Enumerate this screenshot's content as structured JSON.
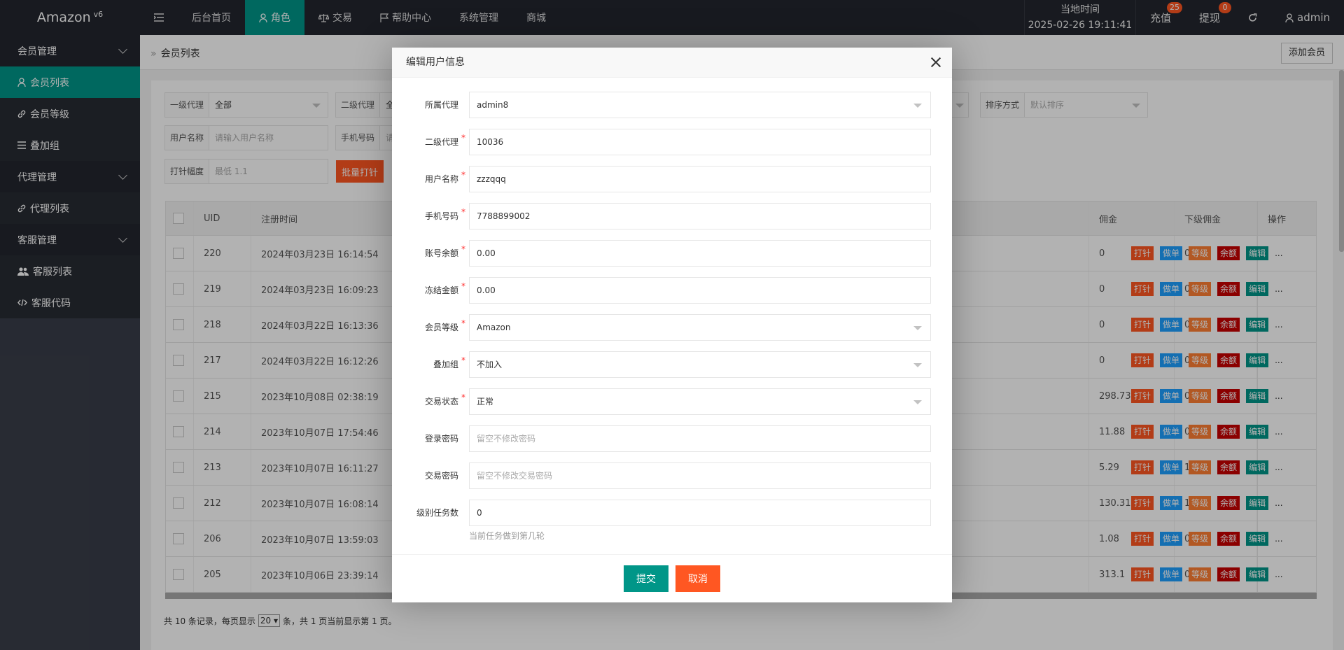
{
  "app": {
    "logo": "Amazon",
    "version": "v6"
  },
  "topnav": [
    {
      "label": "后台首页",
      "icon": ""
    },
    {
      "label": "角色",
      "icon": "user-icon"
    },
    {
      "label": "交易",
      "icon": "scale-icon"
    },
    {
      "label": "帮助中心",
      "icon": "flag-icon"
    },
    {
      "label": "系统管理",
      "icon": ""
    },
    {
      "label": "商城",
      "icon": ""
    }
  ],
  "header_right": {
    "clock_label": "当地时间",
    "clock_value": "2025-02-26 19:11:41",
    "recharge": {
      "label": "充值",
      "badge": "25"
    },
    "withdraw": {
      "label": "提现",
      "badge": "0"
    },
    "user": "admin"
  },
  "sidebar": {
    "group1": "会员管理",
    "item1": "会员列表",
    "item2": "会员等级",
    "item3": "叠加组",
    "group2": "代理管理",
    "item4": "代理列表",
    "group3": "客服管理",
    "item5": "客服列表",
    "item6": "客服代码"
  },
  "breadcrumb": "会员列表",
  "add_member_button": "添加会员",
  "filters": {
    "agent1_label": "一级代理",
    "agent1_value": "全部",
    "agent2_label": "二级代理",
    "agent2_value": "全",
    "username_label": "用户名称",
    "username_placeholder": "请输入用户名称",
    "phone_label": "手机号码",
    "phone_value": "请",
    "sort_label": "排序方式",
    "sort_value": "默认排序",
    "needle_label": "打针幅度",
    "needle_placeholder": "最低 1.1",
    "batch_button": "批量打针"
  },
  "table": {
    "headers": {
      "uid": "UID",
      "reg_time": "注册时间",
      "commission": "佣金",
      "sub_commission": "下级佣金",
      "actions": "操作"
    },
    "rows": [
      {
        "uid": "220",
        "time": "2024年03月23日 16:14:54",
        "commission": "0",
        "sub": "0"
      },
      {
        "uid": "219",
        "time": "2024年03月23日 16:09:23",
        "commission": "0",
        "sub": "0"
      },
      {
        "uid": "218",
        "time": "2024年03月22日 16:13:36",
        "commission": "0",
        "sub": "0"
      },
      {
        "uid": "217",
        "time": "2024年03月22日 16:12:26",
        "commission": "0",
        "sub": "0"
      },
      {
        "uid": "215",
        "time": "2023年10月08日 02:38:19",
        "commission": "298.73",
        "sub": "0"
      },
      {
        "uid": "214",
        "time": "2023年10月07日 17:54:46",
        "commission": "11.88",
        "sub": "0"
      },
      {
        "uid": "213",
        "time": "2023年10月07日 16:11:27",
        "commission": "5.29",
        "sub": "1.19"
      },
      {
        "uid": "212",
        "time": "2023年10月07日 16:08:14",
        "commission": "130.31",
        "sub": "1.98"
      },
      {
        "uid": "206",
        "time": "2023年10月07日 13:59:03",
        "commission": "1.08",
        "sub": "0"
      },
      {
        "uid": "205",
        "time": "2023年10月06日 23:39:14",
        "commission": "313.1",
        "sub": "0"
      }
    ],
    "ops": [
      "打针",
      "做单",
      "等级",
      "余额",
      "编辑"
    ],
    "more": "..."
  },
  "pager": {
    "prefix": "共 10 条记录，每页显示",
    "page_size": "20",
    "suffix": "条，共 1 页当前显示第 1 页。"
  },
  "modal": {
    "title": "编辑用户信息",
    "fields": {
      "agent": {
        "label": "所属代理",
        "value": "admin8"
      },
      "sub_agent": {
        "label": "二级代理",
        "value": "10036"
      },
      "username": {
        "label": "用户名称",
        "value": "zzzqqq"
      },
      "phone": {
        "label": "手机号码",
        "value": "7788899002"
      },
      "balance": {
        "label": "账号余额",
        "value": "0.00"
      },
      "frozen": {
        "label": "冻结金额",
        "value": "0.00"
      },
      "level": {
        "label": "会员等级",
        "value": "Amazon"
      },
      "stack_group": {
        "label": "叠加组",
        "value": "不加入"
      },
      "trade_status": {
        "label": "交易状态",
        "value": "正常"
      },
      "login_pwd": {
        "label": "登录密码",
        "placeholder": "留空不修改密码"
      },
      "trade_pwd": {
        "label": "交易密码",
        "placeholder": "留空不修改交易密码"
      },
      "task_count": {
        "label": "级别任务数",
        "value": "0",
        "hint": "当前任务做到第几轮"
      }
    },
    "required_mark": "*",
    "submit": "提交",
    "cancel": "取消"
  }
}
